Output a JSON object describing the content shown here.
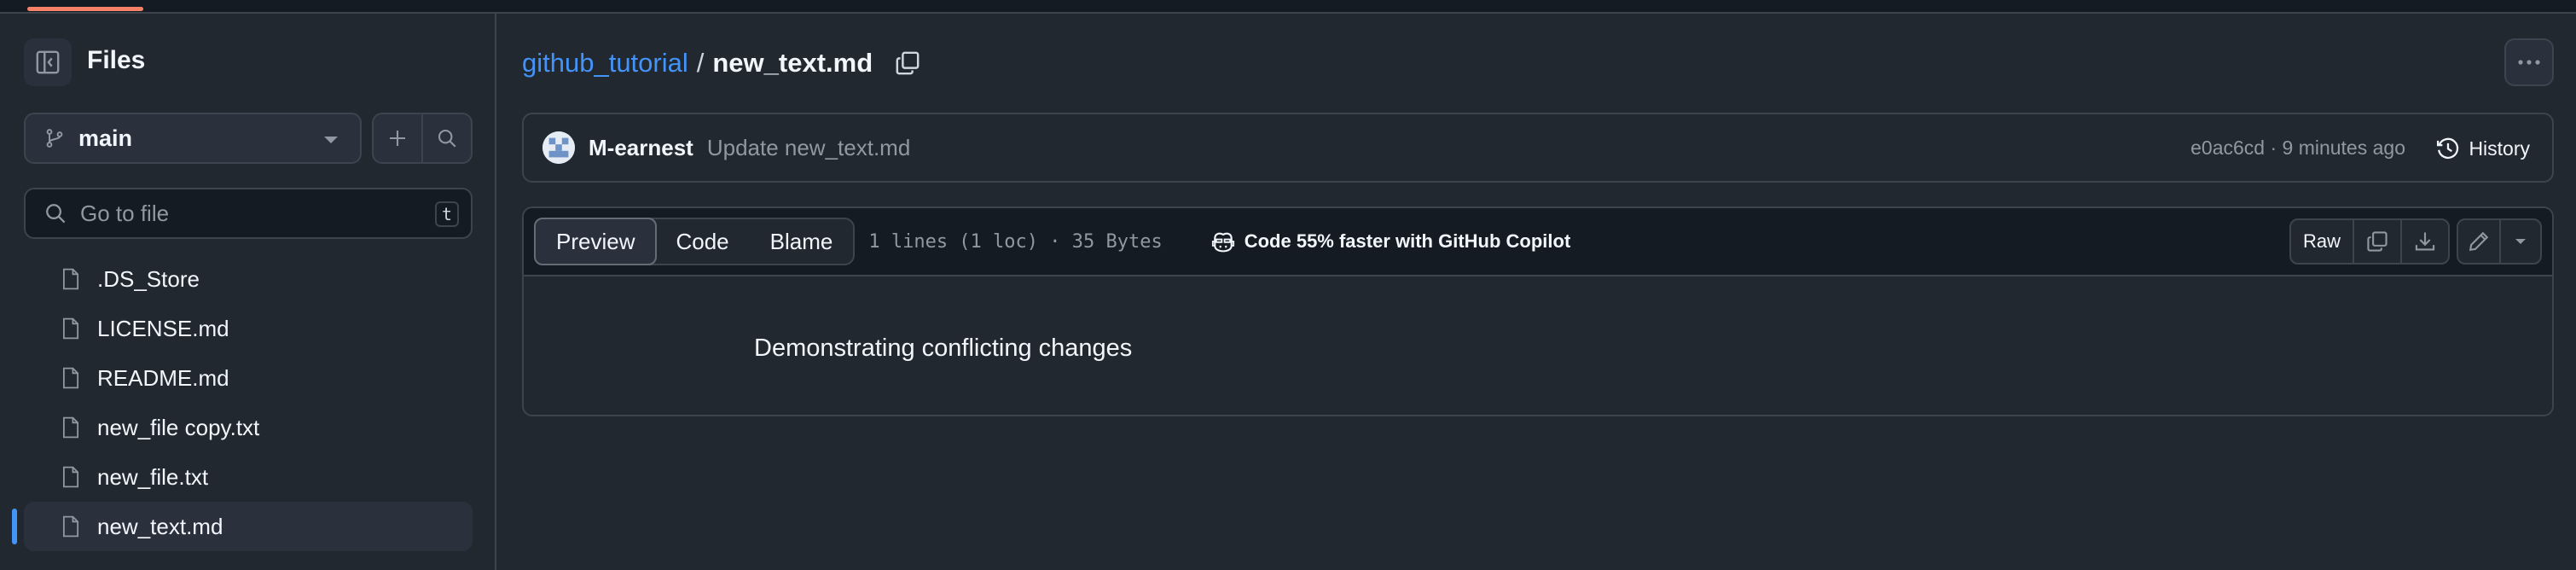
{
  "sidebar": {
    "title": "Files",
    "branch": "main",
    "search_placeholder": "Go to file",
    "search_shortcut": "t",
    "files": [
      {
        "name": ".DS_Store"
      },
      {
        "name": "LICENSE.md"
      },
      {
        "name": "README.md"
      },
      {
        "name": "new_file copy.txt"
      },
      {
        "name": "new_file.txt"
      },
      {
        "name": "new_text.md",
        "selected": true
      }
    ]
  },
  "breadcrumb": {
    "repo": "github_tutorial",
    "separator": "/",
    "file": "new_text.md"
  },
  "commit": {
    "author": "M-earnest",
    "message": "Update new_text.md",
    "meta": "e0ac6cd · 9 minutes ago",
    "history_label": "History"
  },
  "viewer": {
    "tabs": [
      "Preview",
      "Code",
      "Blame"
    ],
    "active_tab": "Preview",
    "file_stats": "1 lines (1 loc) · 35 Bytes",
    "copilot_text": "Code 55% faster with GitHub Copilot",
    "raw_label": "Raw",
    "content": "Demonstrating conflicting changes"
  },
  "colors": {
    "background": "#212830",
    "accent_link": "#4493f8",
    "tab_underline": "#f78166",
    "border": "#3d444d"
  }
}
